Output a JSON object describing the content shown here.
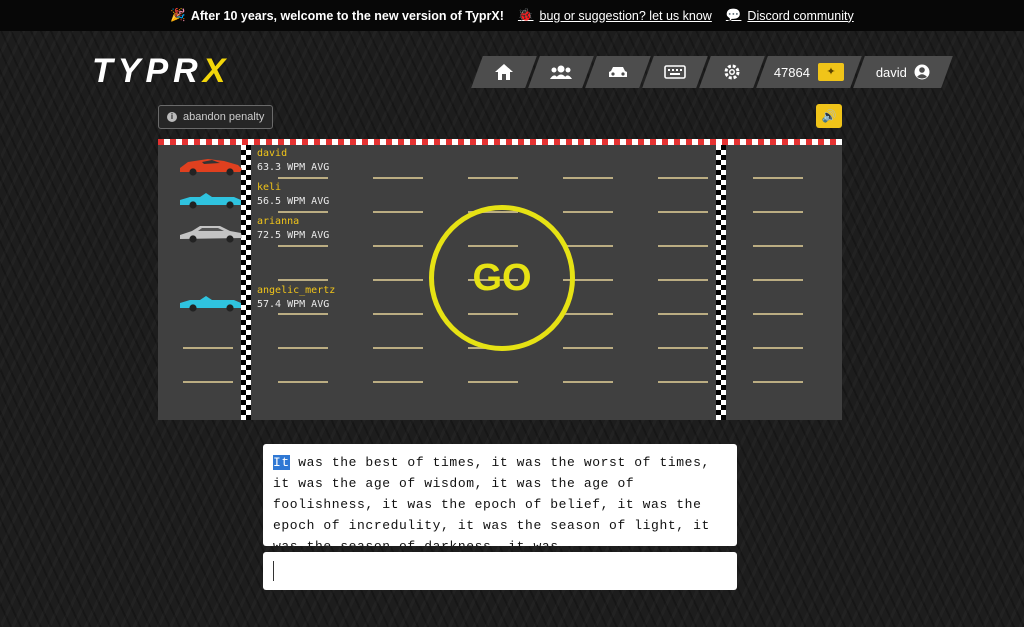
{
  "topbar": {
    "announcement": "After 10 years, welcome to the new version of TyprX!",
    "bug_link": "bug or suggestion? let us know",
    "discord_link": "Discord community"
  },
  "brand": {
    "logo_main": "TYPR",
    "logo_accent": "X"
  },
  "nav": {
    "items": [
      "home-icon",
      "users-icon",
      "car-icon",
      "keyboard-icon",
      "gear-icon"
    ],
    "coins": "47864",
    "username": "david"
  },
  "toolbar": {
    "penalty_label": "abandon penalty"
  },
  "race": {
    "status": "GO",
    "racers": [
      {
        "name": "david",
        "wpm": "63.3 WPM AVG",
        "car_color": "#e0401f"
      },
      {
        "name": "keli",
        "wpm": "56.5 WPM AVG",
        "car_color": "#2fc3df"
      },
      {
        "name": "arianna",
        "wpm": "72.5 WPM AVG",
        "car_color": "#bfbfbf"
      },
      {
        "name": "angelic_mertz",
        "wpm": "57.4 WPM AVG",
        "car_color": "#2fc3df"
      }
    ]
  },
  "passage": {
    "current_word": "It",
    "rest": " was the best of times, it was the worst of times, it was the age of wisdom, it was the age of foolishness, it was the epoch of belief, it was the epoch of incredulity, it was the season of light, it was the season of darkness, it was"
  },
  "input": {
    "value": ""
  },
  "colors": {
    "accent": "#f0c419",
    "go": "#e6e214"
  }
}
